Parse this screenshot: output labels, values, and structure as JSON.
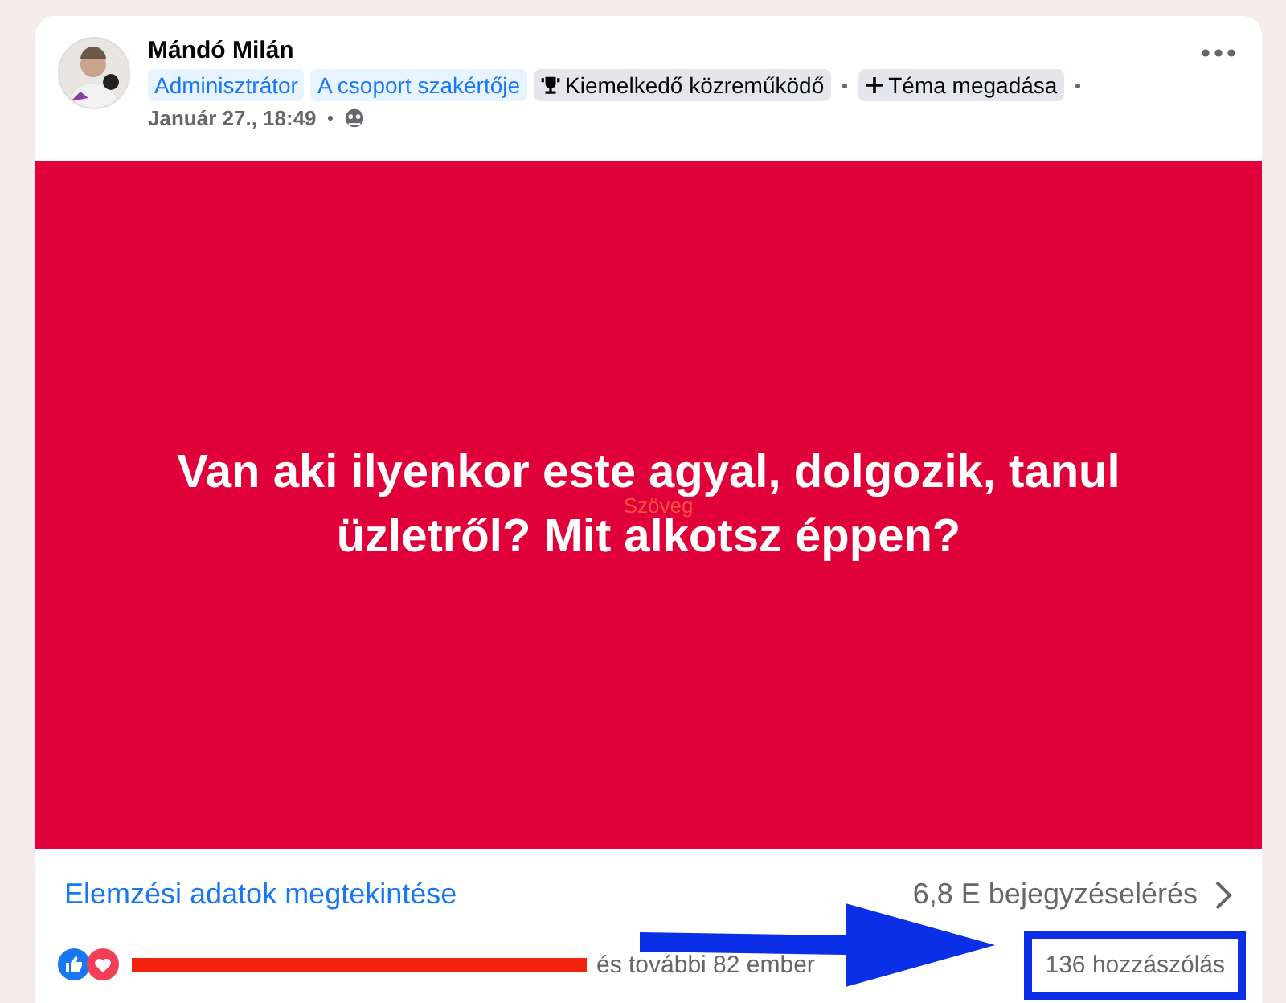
{
  "post": {
    "author": "Mándó Milán",
    "badges": [
      {
        "label": "Adminisztrátor",
        "kind": "role"
      },
      {
        "label": "A csoport szakértője",
        "kind": "role"
      },
      {
        "label": "Kiemelkedő közreműködő",
        "kind": "award"
      },
      {
        "label": "Téma megadása",
        "kind": "add"
      }
    ],
    "timestamp": "Január 27., 18:49",
    "image_text_lines": [
      "Van aki ilyenkor este agyal, dolgozik, tanul",
      "üzletről? Mit alkotsz éppen?"
    ],
    "overlay_label": "Szöveg",
    "insights_link": "Elemzési adatok megtekintése",
    "reach": "6,8 E bejegyzéselérés",
    "reactions_text": "és további 82 ember",
    "comments": "136 hozzászólás"
  }
}
